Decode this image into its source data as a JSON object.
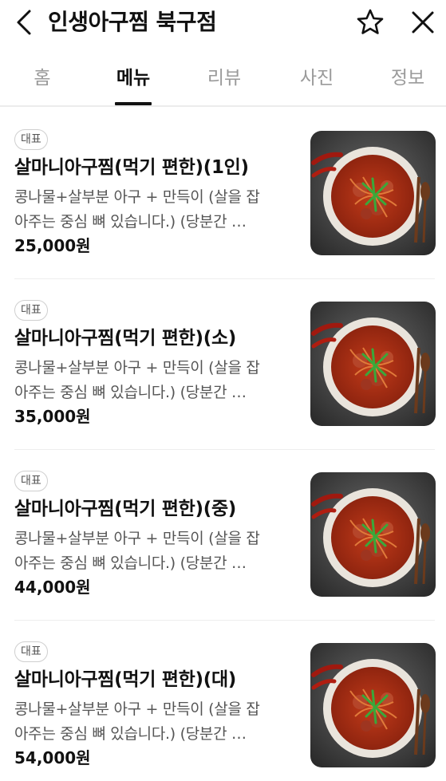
{
  "header": {
    "title": "인생아구찜 북구점",
    "back_icon": "chevron-left-icon",
    "favorite_icon": "star-outline-icon",
    "close_icon": "close-icon"
  },
  "tabs": [
    {
      "label": "홈",
      "active": false
    },
    {
      "label": "메뉴",
      "active": true
    },
    {
      "label": "리뷰",
      "active": false
    },
    {
      "label": "사진",
      "active": false
    },
    {
      "label": "정보",
      "active": false
    }
  ],
  "menu_items": [
    {
      "badge": "대표",
      "name": "살마니아구찜(먹기 편한)(1인)",
      "desc_line1": "콩나물+살부분 아구 + 만득이 (살을 잡",
      "desc_line2": "아주는 중심 뼈 있습니다.) (당분간 …",
      "price": "25,000원"
    },
    {
      "badge": "대표",
      "name": "살마니아구찜(먹기 편한)(소)",
      "desc_line1": "콩나물+살부분 아구 + 만득이 (살을 잡",
      "desc_line2": "아주는 중심 뼈 있습니다.) (당분간 …",
      "price": "35,000원"
    },
    {
      "badge": "대표",
      "name": "살마니아구찜(먹기 편한)(중)",
      "desc_line1": "콩나물+살부분 아구 + 만득이 (살을 잡",
      "desc_line2": "아주는 중심 뼈 있습니다.) (당분간 …",
      "price": "44,000원"
    },
    {
      "badge": "대표",
      "name": "살마니아구찜(먹기 편한)(대)",
      "desc_line1": "콩나물+살부분 아구 + 만득이 (살을 잡",
      "desc_line2": "아주는 중심 뼈 있습니다.) (당분간 …",
      "price": "54,000원"
    }
  ],
  "colors": {
    "text_primary": "#111111",
    "text_secondary": "#555555",
    "tab_inactive": "#9a9a9a",
    "divider": "#ededed"
  }
}
